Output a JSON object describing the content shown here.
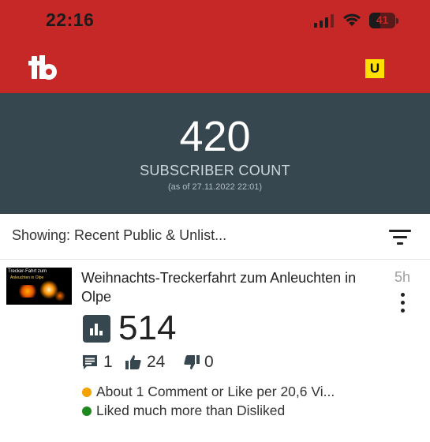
{
  "status_bar": {
    "time": "22:16",
    "battery_percent": "41",
    "battery_level": 0.41
  },
  "app_bar": {
    "logo_icon": "tubebuddy-logo-icon",
    "badge": "U",
    "colors": {
      "bar": "#c62828",
      "badge": "#ffe000"
    }
  },
  "subscribers": {
    "count": "420",
    "label": "SUBSCRIBER COUNT",
    "as_of": "(as of 27.11.2022 22:01)"
  },
  "filter": {
    "label": "Showing: Recent Public & Unlist...",
    "icon": "filter-icon"
  },
  "video": {
    "thumbnail_caption": "Trecker-Fahrt zum",
    "thumbnail_caption_2": "Anleuchten in Olpe",
    "title": "Weihnachts-Treckerfahrt zum Anleuchten in Olpe",
    "age": "5h",
    "views": "514",
    "comments": "1",
    "likes": "24",
    "dislikes": "0",
    "hints": [
      {
        "text": "About 1 Comment or Like per 20,6 Vi...",
        "color": "#f5a300"
      },
      {
        "text": "Liked much more than Disliked",
        "color": "#1e8a1e"
      }
    ]
  }
}
